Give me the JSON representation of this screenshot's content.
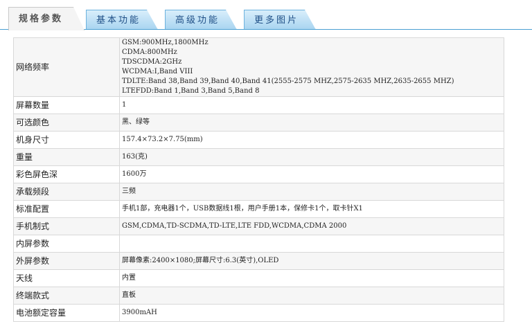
{
  "tabs": [
    {
      "label": "规格参数",
      "active": true
    },
    {
      "label": "基本功能",
      "active": false
    },
    {
      "label": "高级功能",
      "active": false
    },
    {
      "label": "更多图片",
      "active": false
    }
  ],
  "colors": {
    "tab_accent": "#4a9fd2",
    "tab_fill": "#a8d4f0",
    "row_alt": "#f6f6f6",
    "border": "#d8d8d8"
  },
  "specs": {
    "network": {
      "label": "网络频率",
      "lines": [
        "GSM:900MHz,1800MHz",
        "CDMA:800MHz",
        "TDSCDMA:2GHz",
        "WCDMA:I,Band VIII",
        "TDLTE:Band 38,Band 39,Band 40,Band 41(2555-2575 MHZ,2575-2635 MHZ,2635-2655 MHZ)",
        "LTEFDD:Band 1,Band 3,Band 5,Band 8"
      ]
    },
    "screen_count": {
      "label": "屏幕数量",
      "value": "1"
    },
    "colors_available": {
      "label": "可选颜色",
      "value": "黑、绿等"
    },
    "dimensions": {
      "label": "机身尺寸",
      "value": "157.4×73.2×7.75(mm)"
    },
    "weight": {
      "label": "重量",
      "value": "163(克)"
    },
    "color_depth": {
      "label": "彩色屏色深",
      "value": "1600万"
    },
    "bands": {
      "label": "承载频段",
      "value": "三频"
    },
    "package": {
      "label": "标准配置",
      "value": "手机1部，充电器1个，USB数据线1根，用户手册1本，保修卡1个，取卡针X1"
    },
    "standard": {
      "label": "手机制式",
      "value": "GSM,CDMA,TD-SCDMA,TD-LTE,LTE FDD,WCDMA,CDMA 2000"
    },
    "inner_screen": {
      "label": "内屏参数",
      "value": ""
    },
    "outer_screen": {
      "label": "外屏参数",
      "value": "屏幕像素:2400×1080;屏幕尺寸:6.3(英寸),OLED"
    },
    "antenna": {
      "label": "天线",
      "value": "内置"
    },
    "form_factor": {
      "label": "终端款式",
      "value": "直板"
    },
    "battery": {
      "label": "电池额定容量",
      "value": "3900mAH"
    }
  }
}
